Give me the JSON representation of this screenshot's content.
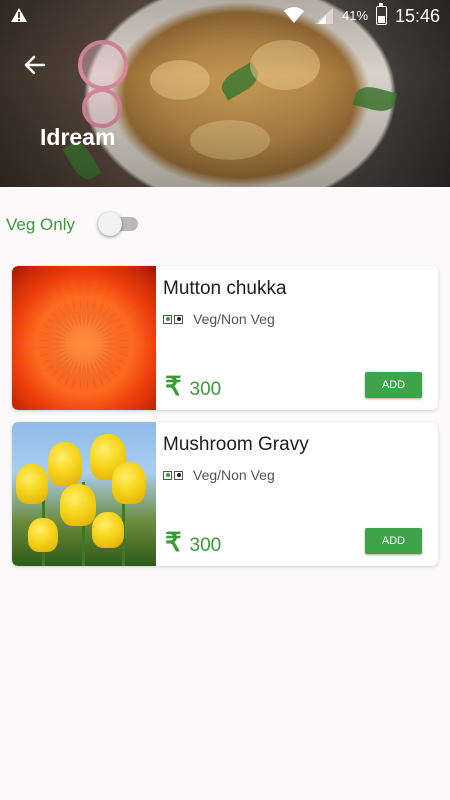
{
  "status_bar": {
    "battery_percent": "41%",
    "time": "15:46",
    "battery_level": 0.41
  },
  "header": {
    "title": "Idream",
    "back_icon": "back-arrow-icon"
  },
  "filter": {
    "veg_only_label": "Veg Only",
    "veg_only_enabled": false
  },
  "colors": {
    "accent_green": "#3a9a3a",
    "button_green": "#3fa34a"
  },
  "menu_items": [
    {
      "name": "Mutton chukka",
      "type_label": "Veg/Non Veg",
      "currency": "₹",
      "price": "300",
      "add_label": "ADD",
      "image": "orange-chrysanthemum-photo"
    },
    {
      "name": "Mushroom Gravy",
      "type_label": "Veg/Non Veg",
      "currency": "₹",
      "price": "300",
      "add_label": "ADD",
      "image": "yellow-tulips-photo"
    }
  ]
}
